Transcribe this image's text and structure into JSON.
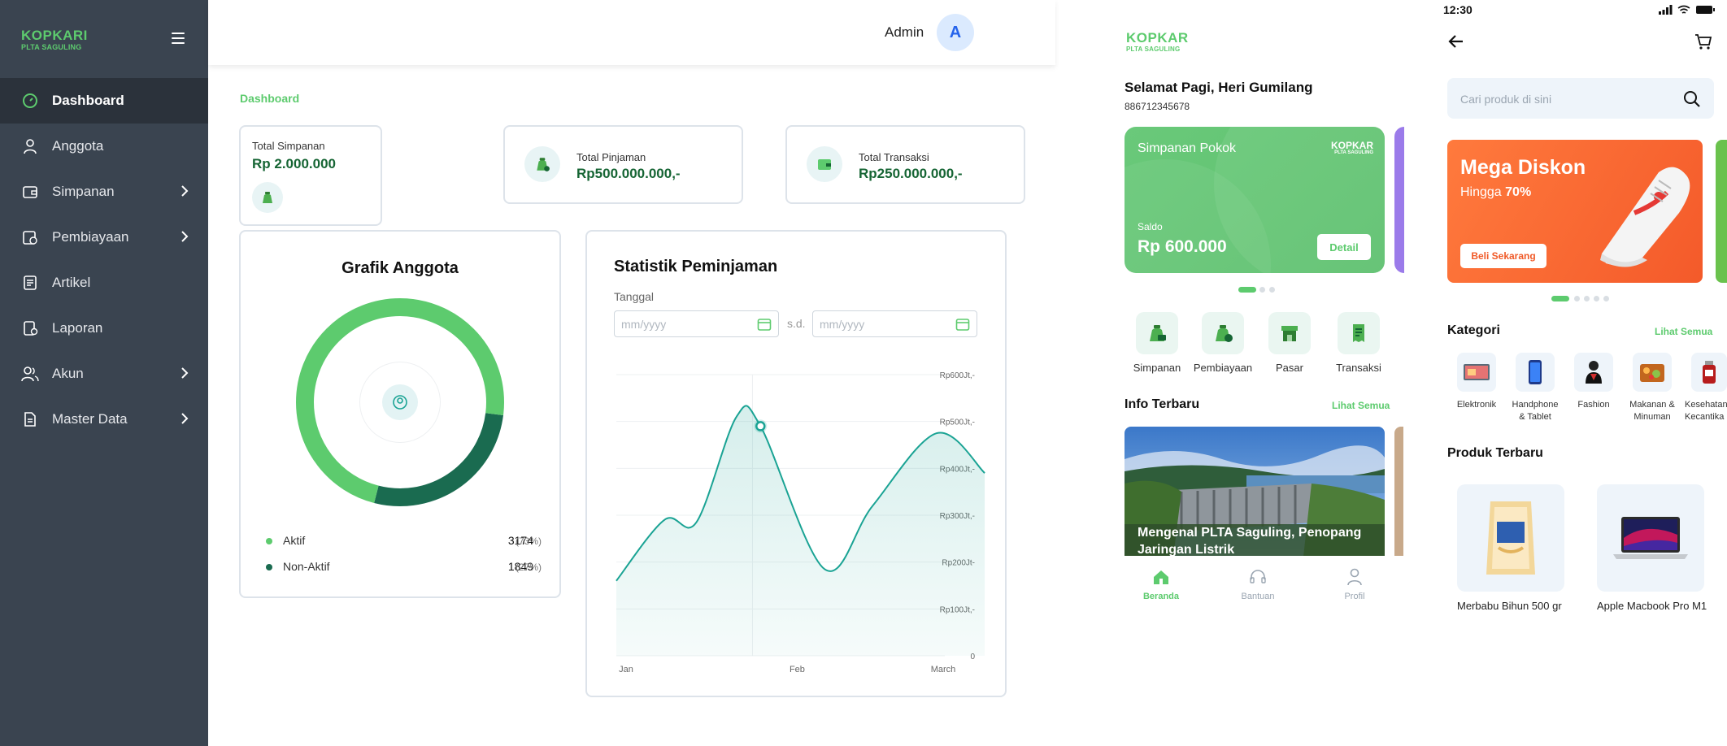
{
  "sidebar": {
    "logo_main": "KOPKARI",
    "logo_sub": "PLTA SAGULING",
    "items": [
      {
        "label": "Dashboard",
        "icon": "gauge-icon"
      },
      {
        "label": "Anggota",
        "icon": "user-icon"
      },
      {
        "label": "Simpanan",
        "icon": "wallet-icon"
      },
      {
        "label": "Pembiayaan",
        "icon": "money-icon"
      },
      {
        "label": "Artikel",
        "icon": "article-icon"
      },
      {
        "label": "Laporan",
        "icon": "report-icon"
      },
      {
        "label": "Akun",
        "icon": "users-icon"
      },
      {
        "label": "Master Data",
        "icon": "document-icon"
      }
    ]
  },
  "topbar": {
    "user_name": "Admin",
    "avatar_initial": "A"
  },
  "breadcrumb": "Dashboard",
  "stats": {
    "simpanan": {
      "label": "Total Simpanan",
      "value": "Rp 2.000.000"
    },
    "pinjaman": {
      "label": "Total Pinjaman",
      "value": "Rp500.000.000,-"
    },
    "transaksi": {
      "label": "Total Transaksi",
      "value": "Rp250.000.000,-"
    }
  },
  "grafik": {
    "title": "Grafik Anggota",
    "aktif": {
      "label": "Aktif",
      "count": "3174",
      "pct": "(73%)",
      "value": 0.73,
      "color": "#5dcb6e"
    },
    "nonaktif": {
      "label": "Non-Aktif",
      "count": "1849",
      "pct": "(27%)",
      "value": 0.27,
      "color": "#1a6b50"
    }
  },
  "statistik": {
    "title": "Statistik Peminjaman",
    "date_label": "Tanggal",
    "from_placeholder": "mm/yyyy",
    "to_placeholder": "mm/yyyy",
    "separator": "s.d."
  },
  "chart_data": {
    "type": "area",
    "x": [
      "Jan",
      "Feb",
      "March"
    ],
    "y_ticks": [
      "Rp600Jt,-",
      "Rp500Jt,-",
      "Rp400Jt,-",
      "Rp300Jt,-",
      "Rp200Jt-",
      "Rp100Jt,-",
      "0"
    ],
    "ylim": [
      0,
      600
    ],
    "grid": true,
    "points": [
      {
        "x": 0.0,
        "y": 160
      },
      {
        "x": 0.3,
        "y": 290
      },
      {
        "x": 0.5,
        "y": 285
      },
      {
        "x": 0.75,
        "y": 510
      },
      {
        "x": 0.9,
        "y": 490
      },
      {
        "x": 1.3,
        "y": 185
      },
      {
        "x": 1.6,
        "y": 320
      },
      {
        "x": 2.0,
        "y": 475
      },
      {
        "x": 2.3,
        "y": 390
      }
    ],
    "highlight_point": {
      "x": 0.9,
      "y": 490
    },
    "line_color": "#1aa394"
  },
  "mobile_home": {
    "logo_main": "KOPKAR",
    "logo_sub": "PLTA SAGULING",
    "greeting": "Selamat Pagi, Heri Gumilang",
    "member_number": "886712345678",
    "savings_card": {
      "title": "Simpanan Pokok",
      "logo_main": "KOPKAR",
      "logo_sub": "PLTA SAGULING",
      "balance_label": "Saldo",
      "balance": "Rp 600.000",
      "button": "Detail"
    },
    "quick_actions": [
      {
        "label": "Simpanan",
        "icon": "savings-bag-icon"
      },
      {
        "label": "Pembiayaan",
        "icon": "financing-bag-icon"
      },
      {
        "label": "Pasar",
        "icon": "store-icon"
      },
      {
        "label": "Transaksi",
        "icon": "receipt-icon"
      }
    ],
    "news_section": "Info Terbaru",
    "news_see_all": "Lihat Semua",
    "news_title": "Mengenal PLTA Saguling, Penopang Jaringan Listrik",
    "bottom_nav": [
      {
        "label": "Beranda",
        "icon": "home-icon",
        "active": true
      },
      {
        "label": "Bantuan",
        "icon": "headset-icon",
        "active": false
      },
      {
        "label": "Profil",
        "icon": "profile-icon",
        "active": false
      }
    ]
  },
  "mobile_shop": {
    "time": "12:30",
    "search_placeholder": "Cari produk di sini",
    "promo": {
      "title": "Mega Diskon",
      "sub_prefix": "Hingga ",
      "sub_value": "70%",
      "button": "Beli Sekarang"
    },
    "category_title": "Kategori",
    "category_see_all": "Lihat Semua",
    "categories": [
      {
        "label": "Elektronik"
      },
      {
        "label": "Handphone & Tablet"
      },
      {
        "label": "Fashion"
      },
      {
        "label": "Makanan & Minuman"
      },
      {
        "label": "Kesehatan Kecantika"
      }
    ],
    "products_title": "Produk Terbaru",
    "products": [
      {
        "name": "Merbabu Bihun 500 gr"
      },
      {
        "name": "Apple Macbook Pro M1"
      }
    ]
  },
  "colors": {
    "brand_green": "#5dcb6e",
    "dark_green": "#1a6b50",
    "sidebar": "#3a4450",
    "teal": "#1aa394"
  }
}
